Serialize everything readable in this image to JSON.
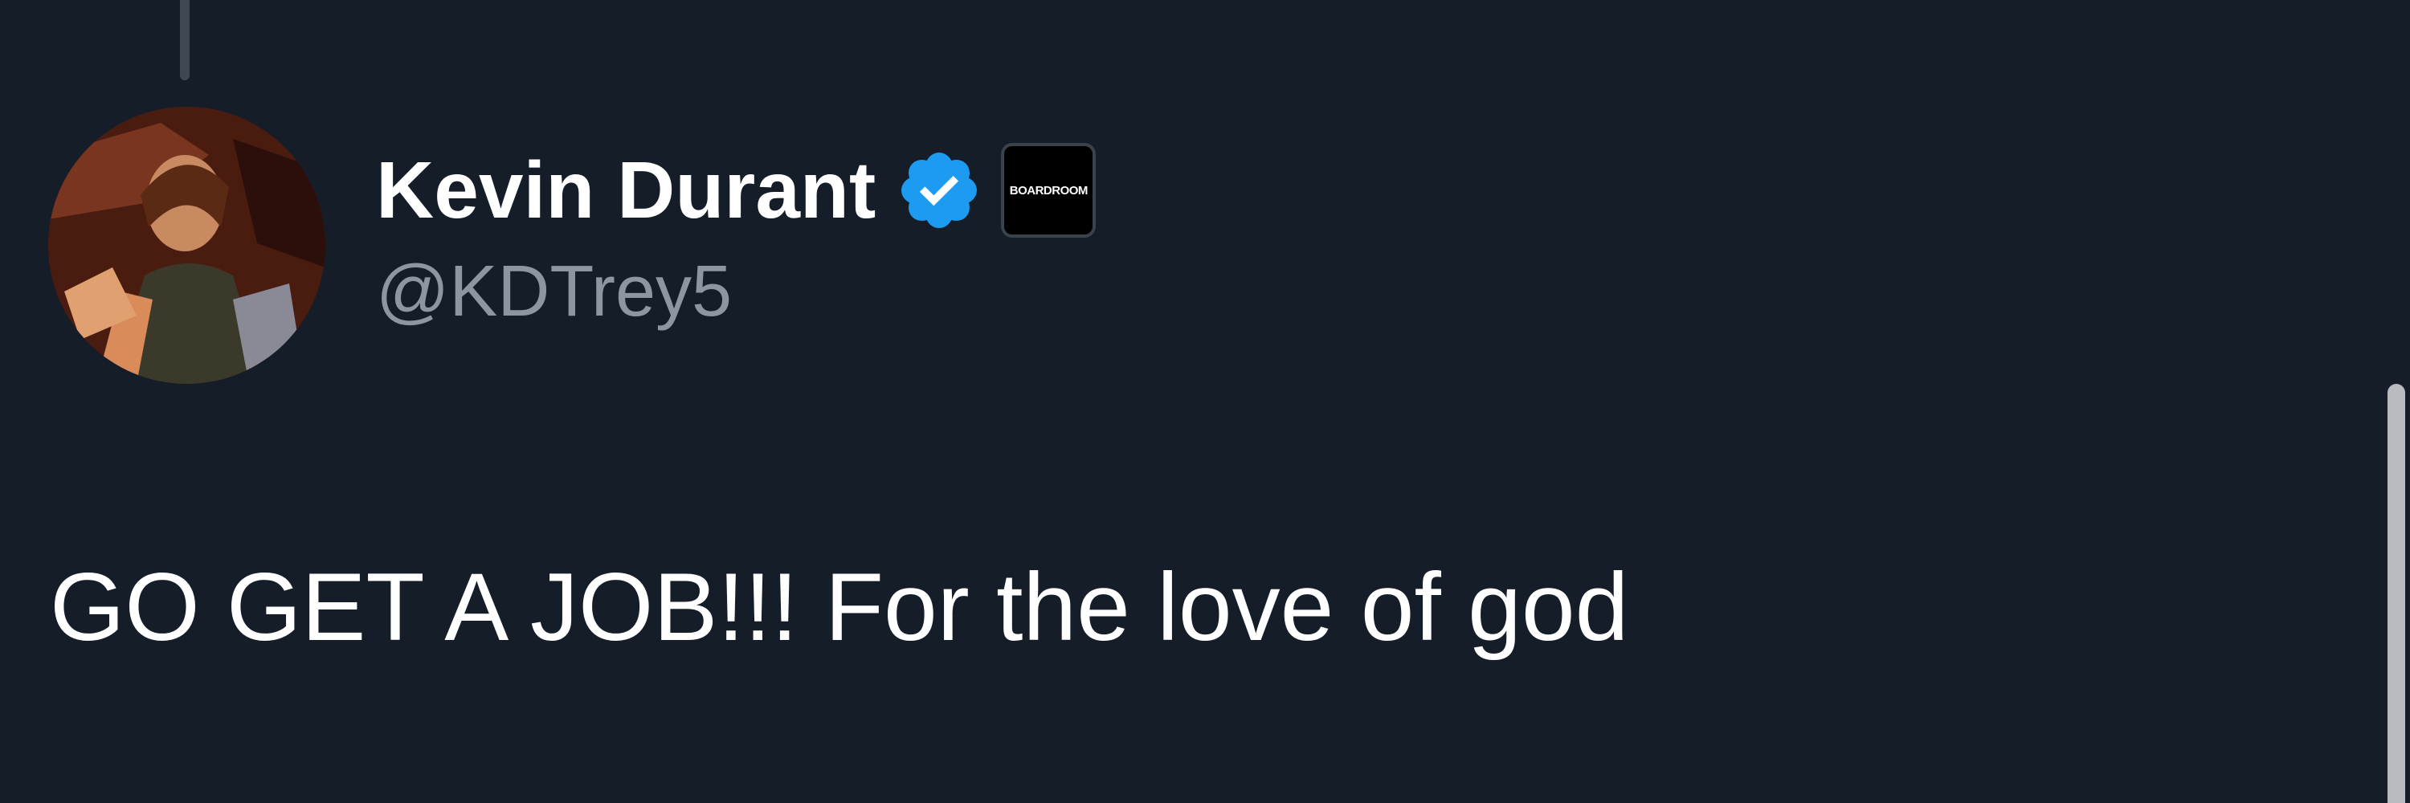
{
  "tweet": {
    "author": {
      "display_name": "Kevin Durant",
      "handle": "@KDTrey5",
      "verified": true,
      "verified_color": "#1d9bf0",
      "affiliate_badge_text": "BOARDROOM",
      "avatar_icon": "profile-avatar-icon"
    },
    "text": "GO GET A JOB!!! For the love of god"
  },
  "theme": {
    "background": "#151d28",
    "primary_text": "#ffffff",
    "secondary_text": "#8b96a0"
  }
}
